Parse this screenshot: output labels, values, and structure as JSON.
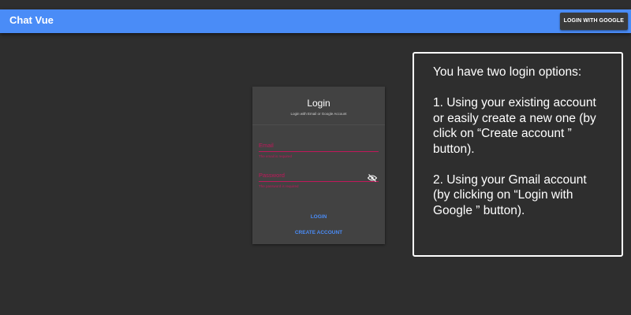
{
  "app_bar": {
    "title": "Chat Vue",
    "google_button_label": "LOGIN WITH GOOGLE"
  },
  "login_card": {
    "title": "Login",
    "subtitle": "Login with Email or Google Account",
    "email": {
      "label": "Email",
      "error": "The email is required"
    },
    "password": {
      "label": "Password",
      "error": "The password is required",
      "toggle_icon": "eye-off-icon"
    },
    "login_label": "LOGIN",
    "create_account_label": "CREATE ACCOUNT"
  },
  "info_box": {
    "intro": "You have two login options:",
    "option1_lines": [
      "1. Using your existing account",
      "or easily create a new one (by",
      "click on “Create account ”",
      "button)."
    ],
    "option2_lines": [
      "2. Using your Gmail account",
      "(by clicking on “Login with",
      "Google ”  button)."
    ]
  },
  "colors": {
    "app_bar": "#4a8cf7",
    "background": "#2e2e2e",
    "card": "#424242",
    "error": "#c2185b",
    "link": "#4a8cf7"
  }
}
